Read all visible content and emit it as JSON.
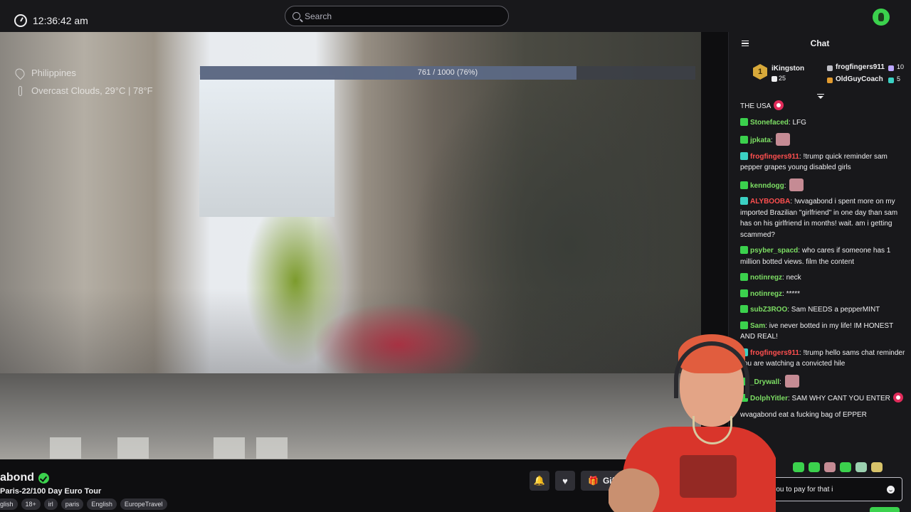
{
  "topbar": {
    "time": "12:36:42 am",
    "search_placeholder": "Search"
  },
  "stream_overlay": {
    "location": "Philippines",
    "weather": "Overcast Clouds, 29°C | 78°F",
    "goal_text": "761 / 1000 (76%)",
    "goal_progress": 0.76
  },
  "channel": {
    "name": "abond",
    "title": "Paris-22/100 Day Euro Tour",
    "tags": [
      "glish",
      "18+",
      "irl",
      "paris",
      "English",
      "EuropeTravel"
    ]
  },
  "actions": {
    "gift_label": "Gift S"
  },
  "chat": {
    "title": "Chat",
    "leaderboard": [
      {
        "rank": "1",
        "name": "iKingston",
        "count": "25",
        "color": "#d8a93a"
      },
      {
        "rank": "",
        "name": "frogfingers911",
        "count": "10",
        "color": "#bfbfc7"
      },
      {
        "rank": "",
        "name": "OldGuyCoach",
        "count": "5",
        "color": "#e29b2f"
      }
    ],
    "messages": [
      {
        "user": "",
        "user_color": "#efeff1",
        "text": "THE USA",
        "emote": "heart"
      },
      {
        "user": "Stonefaced",
        "user_color": "#7ddf64",
        "text": "LFG"
      },
      {
        "user": "jpkata",
        "user_color": "#7ddf64",
        "text": "",
        "emote": "face"
      },
      {
        "user": "frogfingers911",
        "user_color": "#ff4f4f",
        "text": "!trump quick reminder sam pepper grapes young disabled girls"
      },
      {
        "user": "kenndogg",
        "user_color": "#7ddf64",
        "text": "",
        "emote": "face"
      },
      {
        "user": "ALYBOOBA",
        "user_color": "#ff4f4f",
        "text": "!wvagabond i spent more on my imported Brazilian \"girlfriend\" in one day than sam has on his girlfriend in months! wait. am i getting scammed?"
      },
      {
        "user": "psyber_spacd",
        "user_color": "#7ddf64",
        "text": "who cares if someone has 1 million botted views. film the content"
      },
      {
        "user": "notinregz",
        "user_color": "#7ddf64",
        "text": "neck"
      },
      {
        "user": "notinregz",
        "user_color": "#7ddf64",
        "text": "*****"
      },
      {
        "user": "subZ3ROO",
        "user_color": "#7ddf64",
        "text": "Sam NEEDS a pepperMINT"
      },
      {
        "user": "Sam",
        "user_color": "#7ddf64",
        "text": "ive never botted in my life! IM HONEST AND REAL!"
      },
      {
        "user": "frogfingers911",
        "user_color": "#ff4f4f",
        "text": "!trump hello sams chat reminder you are watching a convicted hile"
      },
      {
        "user": "_Drywall",
        "user_color": "#7ddf64",
        "text": "",
        "emote": "face"
      },
      {
        "user": "DolphYitler",
        "user_color": "#7ddf64",
        "text": "SAM WHY CANT YOU ENTER",
        "emote": "heart"
      },
      {
        "user": "",
        "user_color": "#efeff1",
        "text": "wvagabond eat a fucking bag of EPPER"
      }
    ],
    "input_value": "o you to pay for that i"
  },
  "colors": {
    "accent": "#3bd14d",
    "chat_bg": "#18181b",
    "page_bg": "#0e0e10"
  },
  "icons": {
    "clock": "clock-icon",
    "search": "search-icon",
    "location": "pin-icon",
    "weather": "thermometer-icon",
    "verified": "verified-icon",
    "bell": "bell-icon",
    "heart": "heart-icon",
    "gift": "gift-icon",
    "chat_collapse": "collapse-icon",
    "emoji": "smile-icon"
  }
}
